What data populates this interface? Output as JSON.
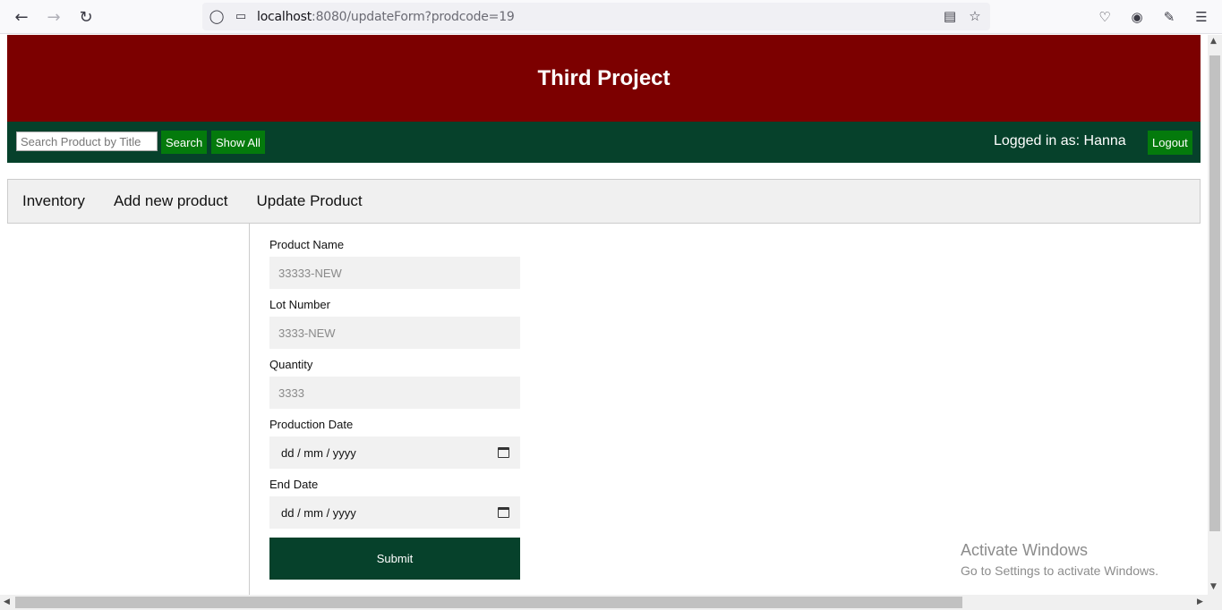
{
  "browser": {
    "url_host": "localhost",
    "url_rest": ":8080/updateForm?prodcode=19"
  },
  "page": {
    "title": "Third Project"
  },
  "topbar": {
    "search_placeholder": "Search Product by Title",
    "search_label": "Search",
    "show_all_label": "Show All",
    "logged_in_text": "Logged in as: Hanna",
    "logout_label": "Logout"
  },
  "menu": {
    "items": [
      {
        "label": "Inventory"
      },
      {
        "label": "Add new product"
      },
      {
        "label": "Update Product"
      }
    ]
  },
  "form": {
    "product_name": {
      "label": "Product Name",
      "placeholder": "33333-NEW"
    },
    "lot_number": {
      "label": "Lot Number",
      "placeholder": "3333-NEW"
    },
    "quantity": {
      "label": "Quantity",
      "placeholder": "3333"
    },
    "production_date": {
      "label": "Production Date",
      "value": "dd / mm / yyyy"
    },
    "end_date": {
      "label": "End Date",
      "value": "dd / mm / yyyy"
    },
    "submit_label": "Submit"
  },
  "watermark": {
    "line1": "Activate Windows",
    "line2": "Go to Settings to activate Windows."
  },
  "colors": {
    "header_bg": "#7c0000",
    "topbar_bg": "#06412b",
    "button_green": "#047a0c"
  }
}
